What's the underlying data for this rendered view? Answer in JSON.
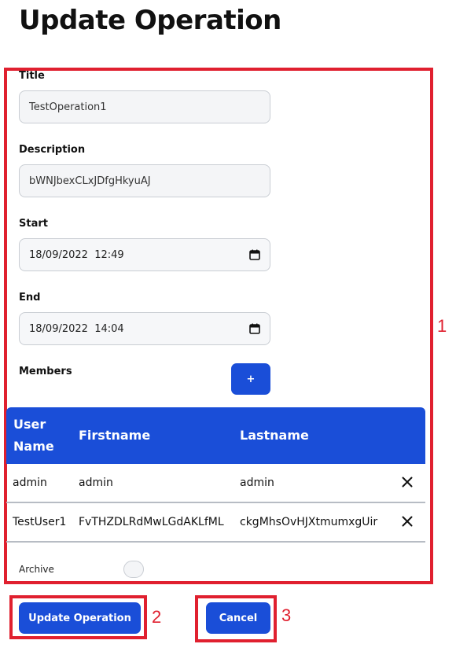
{
  "page": {
    "title": "Update Operation"
  },
  "form": {
    "title_label": "Title",
    "title_value": "TestOperation1",
    "description_label": "Description",
    "description_value": "bWNJbexCLxJDfgHkyuAJ",
    "start_label": "Start",
    "start_value": "18/09/2022  12:49",
    "end_label": "End",
    "end_value": "18/09/2022  14:04",
    "members_label": "Members",
    "add_member_label": "+",
    "archive_label": "Archive",
    "archive_checked": false
  },
  "members_table": {
    "headers": [
      "User\nName",
      "Firstname",
      "Lastname"
    ],
    "rows": [
      {
        "username": "admin",
        "firstname": "admin",
        "lastname": "admin"
      },
      {
        "username": "TestUser1",
        "firstname": "FvTHZDLRdMwLGdAKLfML",
        "lastname": "ckgMhsOvHJXtmumxgUir"
      }
    ]
  },
  "actions": {
    "update_label": "Update Operation",
    "cancel_label": "Cancel"
  },
  "annotations": {
    "form_box": "1",
    "update_box": "2",
    "cancel_box": "3"
  },
  "colors": {
    "primary": "#1a4ed8",
    "annotation": "#e0202f"
  }
}
